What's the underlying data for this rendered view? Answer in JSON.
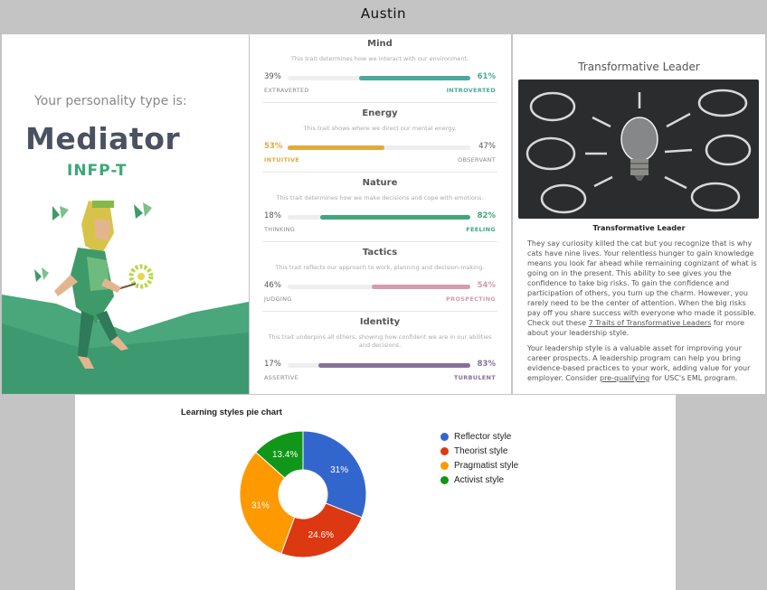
{
  "page": {
    "title": "Austin"
  },
  "personality": {
    "lead": "Your personality type is:",
    "type": "Mediator",
    "code": "INFP-T"
  },
  "traits": [
    {
      "name": "Mind",
      "desc": "This trait determines how we interact with our environment.",
      "left_pct": "39%",
      "right_pct": "61%",
      "left_label": "EXTRAVERTED",
      "right_label": "INTROVERTED",
      "dominant": "right",
      "value": 61,
      "color": "#4ba89a"
    },
    {
      "name": "Energy",
      "desc": "This trait shows where we direct our mental energy.",
      "left_pct": "53%",
      "right_pct": "47%",
      "left_label": "INTUITIVE",
      "right_label": "OBSERVANT",
      "dominant": "left",
      "value": 53,
      "color": "#e2a93d"
    },
    {
      "name": "Nature",
      "desc": "This trait determines how we make decisions and cope with emotions.",
      "left_pct": "18%",
      "right_pct": "82%",
      "left_label": "THINKING",
      "right_label": "FEELING",
      "dominant": "right",
      "value": 82,
      "color": "#3fa87a"
    },
    {
      "name": "Tactics",
      "desc": "This trait reflects our approach to work, planning and decision-making.",
      "left_pct": "46%",
      "right_pct": "54%",
      "left_label": "JUDGING",
      "right_label": "PROSPECTING",
      "dominant": "right",
      "value": 54,
      "color": "#d59bb1"
    },
    {
      "name": "Identity",
      "desc": "This trait underpins all others, showing how confident we are in our abilities and decisions.",
      "left_pct": "17%",
      "right_pct": "83%",
      "left_label": "ASSERTIVE",
      "right_label": "TURBULENT",
      "dominant": "right",
      "value": 83,
      "color": "#8a6f9c"
    }
  ],
  "article": {
    "title": "Transformative Leader",
    "caption": "Transformative Leader",
    "p1": "They say curiosity killed the cat but you recognize that is why cats have nine lives. Your relentless hunger to gain knowledge means you look far ahead while remaining cognizant of what is going on in the present. This ability to see gives you the confidence to take big risks. To gain the confidence and participation of others, you turn up the charm. However, you rarely need to be the center of attention. When the big risks pay off you share success with everyone who made it possible. Check out these ",
    "p1_link": "7 Traits of Transformative Leaders",
    "p1_end": " for more about your leadership style.",
    "p2": "Your leadership style is a valuable asset for improving your career prospects. A leadership program can help you bring evidence-based practices to your work, adding value for your employer. Consider ",
    "p2_link": "pre-qualifying",
    "p2_end": " for USC's EML program."
  },
  "chart_data": {
    "type": "pie",
    "title": "Learning styles pie chart",
    "donut": true,
    "legend_position": "right",
    "categories": [
      "Reflector style",
      "Theorist style",
      "Pragmatist style",
      "Activist style"
    ],
    "values": [
      31,
      24.6,
      31,
      13.4
    ],
    "labels": [
      "31%",
      "24.6%",
      "31%",
      "13.4%"
    ],
    "colors": [
      "#3366cc",
      "#dc3912",
      "#ff9900",
      "#109618"
    ]
  }
}
